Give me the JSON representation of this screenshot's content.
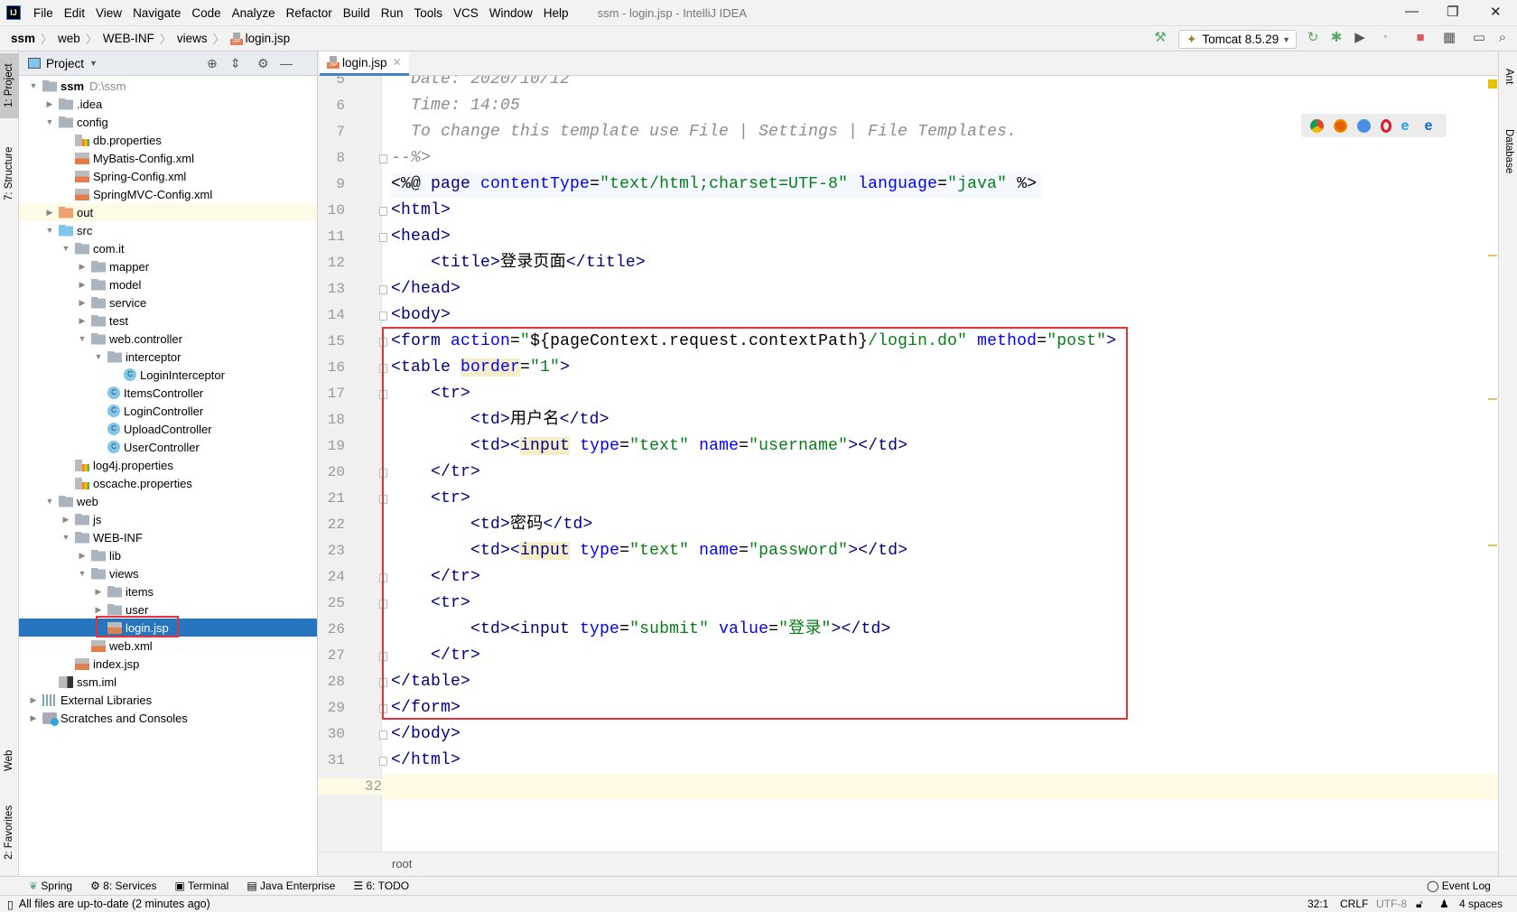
{
  "window": {
    "title": "ssm - login.jsp - IntelliJ IDEA",
    "logo": "IJ"
  },
  "menu": [
    "File",
    "Edit",
    "View",
    "Navigate",
    "Code",
    "Analyze",
    "Refactor",
    "Build",
    "Run",
    "Tools",
    "VCS",
    "Window",
    "Help"
  ],
  "breadcrumb": [
    "ssm",
    "web",
    "WEB-INF",
    "views",
    "login.jsp"
  ],
  "run_config": {
    "label": "Tomcat 8.5.29"
  },
  "left_stripe": {
    "project": "1: Project",
    "structure": "7: Structure",
    "web": "Web",
    "favorites": "2: Favorites"
  },
  "right_stripe": {
    "ant": "Ant",
    "database": "Database"
  },
  "project_panel": {
    "title": "Project"
  },
  "tree": [
    {
      "label": "ssm",
      "hint": "D:\\ssm",
      "level": 0,
      "state": "open",
      "icon": "folder",
      "bold": true
    },
    {
      "label": ".idea",
      "level": 1,
      "state": "closed",
      "icon": "folder"
    },
    {
      "label": "config",
      "level": 1,
      "state": "open",
      "icon": "folder"
    },
    {
      "label": "db.properties",
      "level": 2,
      "state": "leaf",
      "icon": "prop"
    },
    {
      "label": "MyBatis-Config.xml",
      "level": 2,
      "state": "leaf",
      "icon": "xml"
    },
    {
      "label": "Spring-Config.xml",
      "level": 2,
      "state": "leaf",
      "icon": "xml"
    },
    {
      "label": "SpringMVC-Config.xml",
      "level": 2,
      "state": "leaf",
      "icon": "xml"
    },
    {
      "label": "out",
      "level": 1,
      "state": "closed",
      "icon": "out",
      "highlight": true
    },
    {
      "label": "src",
      "level": 1,
      "state": "open",
      "icon": "src"
    },
    {
      "label": "com.it",
      "level": 2,
      "state": "open",
      "icon": "folder"
    },
    {
      "label": "mapper",
      "level": 3,
      "state": "closed",
      "icon": "folder"
    },
    {
      "label": "model",
      "level": 3,
      "state": "closed",
      "icon": "folder"
    },
    {
      "label": "service",
      "level": 3,
      "state": "closed",
      "icon": "folder"
    },
    {
      "label": "test",
      "level": 3,
      "state": "closed",
      "icon": "folder"
    },
    {
      "label": "web.controller",
      "level": 3,
      "state": "open",
      "icon": "folder"
    },
    {
      "label": "interceptor",
      "level": 4,
      "state": "open",
      "icon": "folder"
    },
    {
      "label": "LoginInterceptor",
      "level": 5,
      "state": "leaf",
      "icon": "cls"
    },
    {
      "label": "ItemsController",
      "level": 4,
      "state": "leaf",
      "icon": "cls"
    },
    {
      "label": "LoginController",
      "level": 4,
      "state": "leaf",
      "icon": "cls"
    },
    {
      "label": "UploadController",
      "level": 4,
      "state": "leaf",
      "icon": "cls"
    },
    {
      "label": "UserController",
      "level": 4,
      "state": "leaf",
      "icon": "cls"
    },
    {
      "label": "log4j.properties",
      "level": 2,
      "state": "leaf",
      "icon": "prop"
    },
    {
      "label": "oscache.properties",
      "level": 2,
      "state": "leaf",
      "icon": "prop"
    },
    {
      "label": "web",
      "level": 1,
      "state": "open",
      "icon": "folder"
    },
    {
      "label": "js",
      "level": 2,
      "state": "closed",
      "icon": "folder"
    },
    {
      "label": "WEB-INF",
      "level": 2,
      "state": "open",
      "icon": "folder"
    },
    {
      "label": "lib",
      "level": 3,
      "state": "closed",
      "icon": "folder"
    },
    {
      "label": "views",
      "level": 3,
      "state": "open",
      "icon": "folder"
    },
    {
      "label": "items",
      "level": 4,
      "state": "closed",
      "icon": "folder"
    },
    {
      "label": "user",
      "level": 4,
      "state": "closed",
      "icon": "folder"
    },
    {
      "label": "login.jsp",
      "level": 4,
      "state": "leaf",
      "icon": "jsp",
      "selected": true
    },
    {
      "label": "web.xml",
      "level": 3,
      "state": "leaf",
      "icon": "xml"
    },
    {
      "label": "index.jsp",
      "level": 2,
      "state": "leaf",
      "icon": "jsp"
    },
    {
      "label": "ssm.iml",
      "level": 1,
      "state": "leaf",
      "icon": "iml"
    },
    {
      "label": "External Libraries",
      "level": 0,
      "state": "closed",
      "icon": "lib"
    },
    {
      "label": "Scratches and Consoles",
      "level": 0,
      "state": "closed",
      "icon": "scr"
    }
  ],
  "editor": {
    "tab": "login.jsp",
    "first_line": 5,
    "current_line": 32,
    "lines": [
      [
        [
          "c",
          "  Date: 2020/10/12"
        ]
      ],
      [
        [
          "c",
          "  Time: 14:05"
        ]
      ],
      [
        [
          "c",
          "  To change this template use File | Settings | File Templates."
        ]
      ],
      [
        [
          "c",
          "--%>"
        ]
      ],
      [
        [
          "p",
          "<%@ "
        ],
        [
          "t",
          "page "
        ],
        [
          "a",
          "contentType"
        ],
        [
          "p",
          "="
        ],
        [
          "s",
          "\"text/html;charset=UTF-8\""
        ],
        [
          "p",
          " "
        ],
        [
          "a",
          "language"
        ],
        [
          "p",
          "="
        ],
        [
          "s",
          "\"java\""
        ],
        [
          "p",
          " %>"
        ]
      ],
      [
        [
          "t",
          "<html>"
        ]
      ],
      [
        [
          "t",
          "<head>"
        ]
      ],
      [
        [
          "p",
          "    "
        ],
        [
          "t",
          "<title>"
        ],
        [
          "p",
          "登录页面"
        ],
        [
          "t",
          "</title>"
        ]
      ],
      [
        [
          "t",
          "</head>"
        ]
      ],
      [
        [
          "t",
          "<body>"
        ]
      ],
      [
        [
          "t",
          "<form "
        ],
        [
          "a",
          "action"
        ],
        [
          "p",
          "="
        ],
        [
          "s",
          "\""
        ],
        [
          "p",
          "${pageContext.request.contextPath}"
        ],
        [
          "s",
          "/login.do\""
        ],
        [
          "p",
          " "
        ],
        [
          "a",
          "method"
        ],
        [
          "p",
          "="
        ],
        [
          "s",
          "\"post\""
        ],
        [
          "t",
          ">"
        ]
      ],
      [
        [
          "t",
          "<table "
        ],
        [
          "ahl",
          "border"
        ],
        [
          "p",
          "="
        ],
        [
          "s",
          "\"1\""
        ],
        [
          "t",
          ">"
        ]
      ],
      [
        [
          "p",
          "    "
        ],
        [
          "t",
          "<tr>"
        ]
      ],
      [
        [
          "p",
          "        "
        ],
        [
          "t",
          "<td>"
        ],
        [
          "p",
          "用户名"
        ],
        [
          "t",
          "</td>"
        ]
      ],
      [
        [
          "p",
          "        "
        ],
        [
          "t",
          "<td><"
        ],
        [
          "thl",
          "input"
        ],
        [
          "p",
          " "
        ],
        [
          "a",
          "type"
        ],
        [
          "p",
          "="
        ],
        [
          "s",
          "\"text\""
        ],
        [
          "p",
          " "
        ],
        [
          "a",
          "name"
        ],
        [
          "p",
          "="
        ],
        [
          "s",
          "\"username\""
        ],
        [
          "t",
          "></td>"
        ]
      ],
      [
        [
          "p",
          "    "
        ],
        [
          "t",
          "</tr>"
        ]
      ],
      [
        [
          "p",
          "    "
        ],
        [
          "t",
          "<tr>"
        ]
      ],
      [
        [
          "p",
          "        "
        ],
        [
          "t",
          "<td>"
        ],
        [
          "p",
          "密码"
        ],
        [
          "t",
          "</td>"
        ]
      ],
      [
        [
          "p",
          "        "
        ],
        [
          "t",
          "<td><"
        ],
        [
          "thl",
          "input"
        ],
        [
          "p",
          " "
        ],
        [
          "a",
          "type"
        ],
        [
          "p",
          "="
        ],
        [
          "s",
          "\"text\""
        ],
        [
          "p",
          " "
        ],
        [
          "a",
          "name"
        ],
        [
          "p",
          "="
        ],
        [
          "s",
          "\"password\""
        ],
        [
          "t",
          "></td>"
        ]
      ],
      [
        [
          "p",
          "    "
        ],
        [
          "t",
          "</tr>"
        ]
      ],
      [
        [
          "p",
          "    "
        ],
        [
          "t",
          "<tr>"
        ]
      ],
      [
        [
          "p",
          "        "
        ],
        [
          "t",
          "<td><input "
        ],
        [
          "a",
          "type"
        ],
        [
          "p",
          "="
        ],
        [
          "s",
          "\"submit\""
        ],
        [
          "p",
          " "
        ],
        [
          "a",
          "value"
        ],
        [
          "p",
          "="
        ],
        [
          "s",
          "\"登录\""
        ],
        [
          "t",
          "></td>"
        ]
      ],
      [
        [
          "p",
          "    "
        ],
        [
          "t",
          "</tr>"
        ]
      ],
      [
        [
          "t",
          "</table>"
        ]
      ],
      [
        [
          "t",
          "</form>"
        ]
      ],
      [
        [
          "t",
          "</body>"
        ]
      ],
      [
        [
          "t",
          "</html>"
        ]
      ],
      []
    ]
  },
  "editor_breadcrumb": "root",
  "tool_windows": [
    "Spring",
    "8: Services",
    "Terminal",
    "Java Enterprise",
    "6: TODO"
  ],
  "event_log": "Event Log",
  "status": {
    "message": "All files are up-to-date (2 minutes ago)",
    "position": "32:1",
    "line_sep": "CRLF",
    "encoding": "UTF-8",
    "indent": "4 spaces"
  },
  "colors": {
    "selection": "#2675bf",
    "highlight_box": "#e5323b",
    "tag": "#000080",
    "attr": "#0000ff",
    "string": "#067d17",
    "comment": "#8c8c8c"
  }
}
